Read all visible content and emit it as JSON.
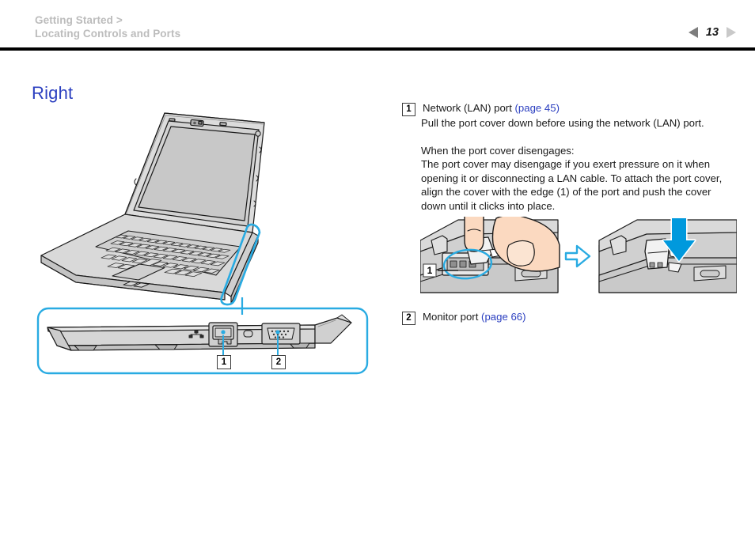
{
  "header": {
    "breadcrumb_line1": "Getting Started >",
    "breadcrumb_line2": "Locating Controls and Ports",
    "page_number": "13",
    "prev_arrow_icon": "triangle-left-icon",
    "next_arrow_icon": "triangle-right-icon",
    "prev_arrow_color": "#7d7d7d",
    "next_arrow_color": "#c9c9c9",
    "breadcrumb_color": "#bcbcbc",
    "rule_color": "#000000"
  },
  "section": {
    "title": "Right",
    "title_color": "#2b3fc0"
  },
  "items": [
    {
      "number": "1",
      "title": "Network (LAN) port",
      "pageref": "(page 45)",
      "paragraphs": [
        "Pull the port cover down before using the network (LAN) port.",
        "When the port cover disengages:",
        "The port cover may disengage if you exert pressure on it when opening it or disconnecting a LAN cable. To attach the port cover, align the cover with the edge (1) of the port and push the cover down until it clicks into place."
      ]
    },
    {
      "number": "2",
      "title": "Monitor port",
      "pageref": "(page 66)",
      "paragraphs": []
    }
  ],
  "illustration": {
    "laptop_alt": "three-quarter view of open notebook computer with right edge highlighted",
    "side_view_alt": "right side profile of notebook showing LAN port and monitor port",
    "callout_1": "1",
    "callout_2": "2",
    "highlight_color": "#29abe2",
    "outline_color": "#1a1a1a",
    "body_fill": "#d4d4d4",
    "screen_fill": "#c8c8c8"
  },
  "procedure": {
    "panel1_alt": "fingers aligning the port cover with the edge of the LAN port",
    "panel2_alt": "blue arrow pressing the port cover down until it clicks",
    "step_arrow_icon": "arrow-right-outline-icon",
    "press_arrow_icon": "arrow-down-solid-icon",
    "callout_1": "1",
    "arrow_color": "#0099dd",
    "skin_color": "#fbd9c0",
    "panel_fill": "#d0d0d0"
  }
}
